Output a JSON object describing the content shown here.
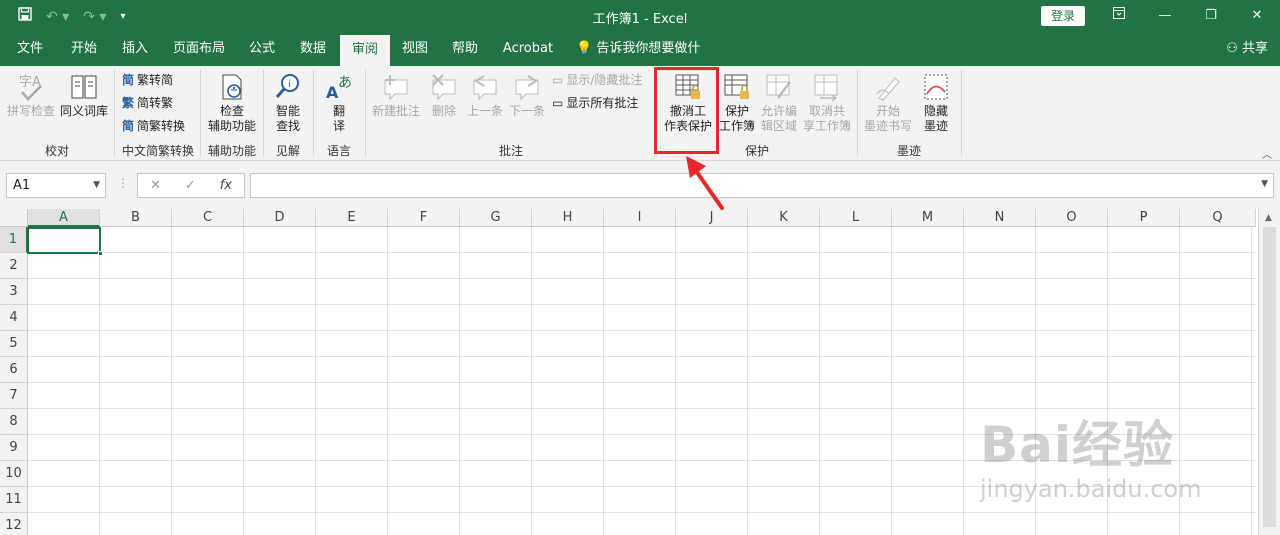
{
  "window": {
    "title": "工作簿1  -  Excel",
    "login": "登录"
  },
  "tabs": [
    {
      "label": "文件"
    },
    {
      "label": "开始"
    },
    {
      "label": "插入"
    },
    {
      "label": "页面布局"
    },
    {
      "label": "公式"
    },
    {
      "label": "数据"
    },
    {
      "label": "审阅"
    },
    {
      "label": "视图"
    },
    {
      "label": "帮助"
    },
    {
      "label": "Acrobat"
    },
    {
      "label": "告诉我你想要做什么"
    }
  ],
  "active_tab": "审阅",
  "share_label": "共享",
  "ribbon": {
    "proofing": {
      "spell": "拼写检查",
      "thesaurus": "同义词库",
      "group": "校对"
    },
    "chinese": {
      "to_trad": "繁转简",
      "to_simp": "简转繁",
      "convert": "简繁转换",
      "group": "中文简繁转换"
    },
    "access": {
      "check1": "检查",
      "check2": "辅助功能",
      "group": "辅助功能"
    },
    "insights": {
      "smart1": "智能",
      "smart2": "查找",
      "group": "见解"
    },
    "language": {
      "translate1": "翻",
      "translate2": "译",
      "group": "语言"
    },
    "comments": {
      "new": "新建批注",
      "delete": "删除",
      "prev": "上一条",
      "next": "下一条",
      "show_hide": "显示/隐藏批注",
      "show_all": "显示所有批注",
      "group": "批注"
    },
    "protect": {
      "unprotect1": "撤消工",
      "unprotect2": "作表保护",
      "protect_wb1": "保护",
      "protect_wb2": "工作簿",
      "allow1": "允许编",
      "allow2": "辑区域",
      "unshare1": "取消共",
      "unshare2": "享工作簿",
      "group": "保护"
    },
    "ink": {
      "start1": "开始",
      "start2": "墨迹书写",
      "hide1": "隐藏",
      "hide2": "墨迹",
      "group": "墨迹"
    }
  },
  "formula_bar": {
    "name_box": "A1",
    "fx": "fx",
    "value": ""
  },
  "columns": [
    "A",
    "B",
    "C",
    "D",
    "E",
    "F",
    "G",
    "H",
    "I",
    "J",
    "K",
    "L",
    "M",
    "N",
    "O",
    "P",
    "Q"
  ],
  "rows": [
    "1",
    "2",
    "3",
    "4",
    "5",
    "6",
    "7",
    "8",
    "9",
    "10",
    "11",
    "12"
  ],
  "watermark": {
    "main": "Bai经验",
    "sub": "jingyan.baidu.com"
  },
  "colors": {
    "brand": "#217346",
    "highlight": "#e8262f"
  }
}
